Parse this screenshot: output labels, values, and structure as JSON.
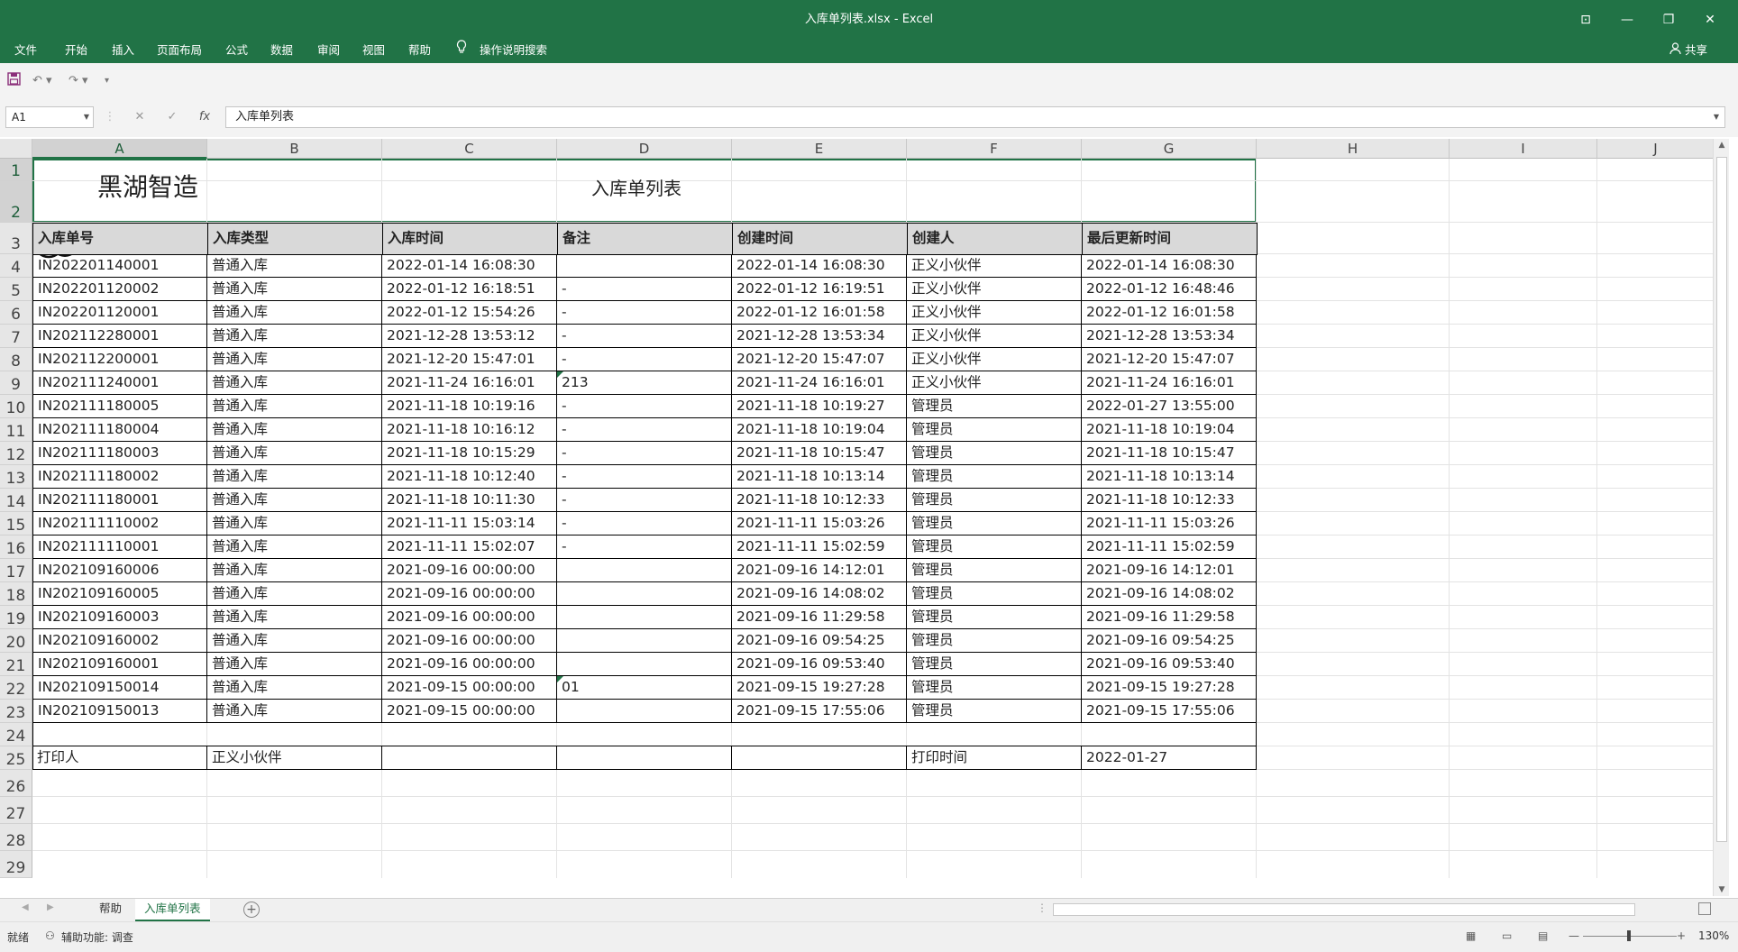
{
  "window": {
    "title": "入库单列表.xlsx  -  Excel",
    "controls": [
      "⊡",
      "—",
      "❐",
      "✕"
    ]
  },
  "ribbon": {
    "tabs": [
      "文件",
      "开始",
      "插入",
      "页面布局",
      "公式",
      "数据",
      "审阅",
      "视图",
      "帮助"
    ],
    "tell_me": "操作说明搜索",
    "share": "共享"
  },
  "formula_bar": {
    "name_box": "A1",
    "formula": "入库单列表"
  },
  "columns": [
    "A",
    "B",
    "C",
    "D",
    "E",
    "F",
    "G",
    "H",
    "I",
    "J"
  ],
  "rows": [
    "1",
    "2",
    "3",
    "4",
    "5",
    "6",
    "7",
    "8",
    "9",
    "10",
    "11",
    "12",
    "13",
    "14",
    "15",
    "16",
    "17",
    "18",
    "19",
    "20",
    "21",
    "22",
    "23",
    "24",
    "25",
    "26",
    "27",
    "28",
    "29"
  ],
  "sheet": {
    "logo_text": "黑湖智造",
    "title": "入库单列表",
    "headers": [
      "入库单号",
      "入库类型",
      "入库时间",
      "备注",
      "创建时间",
      "创建人",
      "最后更新时间"
    ],
    "records": [
      [
        "IN202201140001",
        "普通入库",
        "2022-01-14 16:08:30",
        "",
        "2022-01-14 16:08:30",
        "正义小伙伴",
        "2022-01-14 16:08:30"
      ],
      [
        "IN202201120002",
        "普通入库",
        "2022-01-12 16:18:51",
        "-",
        "2022-01-12 16:19:51",
        "正义小伙伴",
        "2022-01-12 16:48:46"
      ],
      [
        "IN202201120001",
        "普通入库",
        "2022-01-12 15:54:26",
        "-",
        "2022-01-12 16:01:58",
        "正义小伙伴",
        "2022-01-12 16:01:58"
      ],
      [
        "IN202112280001",
        "普通入库",
        "2021-12-28 13:53:12",
        "-",
        "2021-12-28 13:53:34",
        "正义小伙伴",
        "2021-12-28 13:53:34"
      ],
      [
        "IN202112200001",
        "普通入库",
        "2021-12-20 15:47:01",
        "-",
        "2021-12-20 15:47:07",
        "正义小伙伴",
        "2021-12-20 15:47:07"
      ],
      [
        "IN202111240001",
        "普通入库",
        "2021-11-24 16:16:01",
        "213",
        "2021-11-24 16:16:01",
        "正义小伙伴",
        "2021-11-24 16:16:01"
      ],
      [
        "IN202111180005",
        "普通入库",
        "2021-11-18 10:19:16",
        "-",
        "2021-11-18 10:19:27",
        "管理员",
        "2022-01-27 13:55:00"
      ],
      [
        "IN202111180004",
        "普通入库",
        "2021-11-18 10:16:12",
        "-",
        "2021-11-18 10:19:04",
        "管理员",
        "2021-11-18 10:19:04"
      ],
      [
        "IN202111180003",
        "普通入库",
        "2021-11-18 10:15:29",
        "-",
        "2021-11-18 10:15:47",
        "管理员",
        "2021-11-18 10:15:47"
      ],
      [
        "IN202111180002",
        "普通入库",
        "2021-11-18 10:12:40",
        "-",
        "2021-11-18 10:13:14",
        "管理员",
        "2021-11-18 10:13:14"
      ],
      [
        "IN202111180001",
        "普通入库",
        "2021-11-18 10:11:30",
        "-",
        "2021-11-18 10:12:33",
        "管理员",
        "2021-11-18 10:12:33"
      ],
      [
        "IN202111110002",
        "普通入库",
        "2021-11-11 15:03:14",
        "-",
        "2021-11-11 15:03:26",
        "管理员",
        "2021-11-11 15:03:26"
      ],
      [
        "IN202111110001",
        "普通入库",
        "2021-11-11 15:02:07",
        "-",
        "2021-11-11 15:02:59",
        "管理员",
        "2021-11-11 15:02:59"
      ],
      [
        "IN202109160006",
        "普通入库",
        "2021-09-16 00:00:00",
        "",
        "2021-09-16 14:12:01",
        "管理员",
        "2021-09-16 14:12:01"
      ],
      [
        "IN202109160005",
        "普通入库",
        "2021-09-16 00:00:00",
        "",
        "2021-09-16 14:08:02",
        "管理员",
        "2021-09-16 14:08:02"
      ],
      [
        "IN202109160003",
        "普通入库",
        "2021-09-16 00:00:00",
        "",
        "2021-09-16 11:29:58",
        "管理员",
        "2021-09-16 11:29:58"
      ],
      [
        "IN202109160002",
        "普通入库",
        "2021-09-16 00:00:00",
        "",
        "2021-09-16 09:54:25",
        "管理员",
        "2021-09-16 09:54:25"
      ],
      [
        "IN202109160001",
        "普通入库",
        "2021-09-16 00:00:00",
        "",
        "2021-09-16 09:53:40",
        "管理员",
        "2021-09-16 09:53:40"
      ],
      [
        "IN202109150014",
        "普通入库",
        "2021-09-15 00:00:00",
        "01",
        "2021-09-15 19:27:28",
        "管理员",
        "2021-09-15 19:27:28"
      ],
      [
        "IN202109150013",
        "普通入库",
        "2021-09-15 00:00:00",
        "",
        "2021-09-15 17:55:06",
        "管理员",
        "2021-09-15 17:55:06"
      ]
    ],
    "footer": {
      "printer_label": "打印人",
      "printer_value": "正义小伙伴",
      "print_time_label": "打印时间",
      "print_time_value": "2022-01-27"
    }
  },
  "sheet_tabs": [
    "帮助",
    "入库单列表"
  ],
  "active_sheet": "入库单列表",
  "status": {
    "ready": "就绪",
    "accessibility": "辅助功能: 调查",
    "zoom": "130%"
  },
  "colors": {
    "excel_green": "#217346",
    "header_fill": "#d9d9d9"
  }
}
